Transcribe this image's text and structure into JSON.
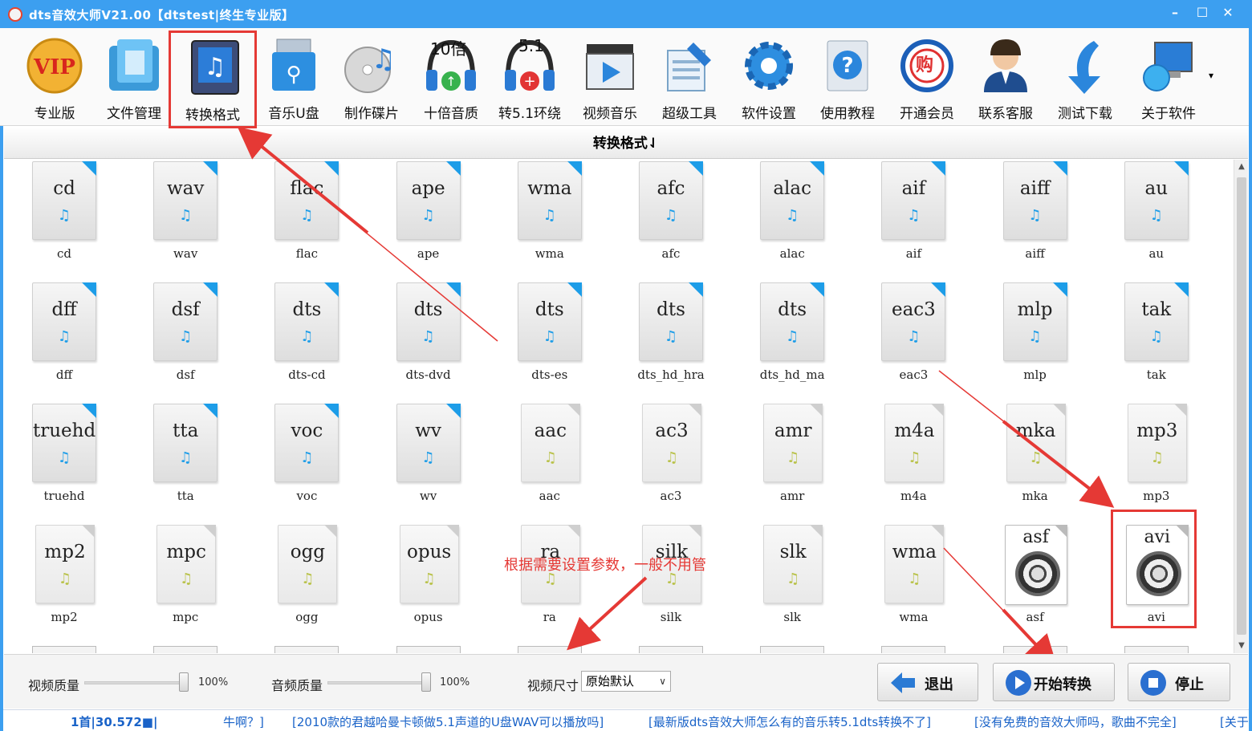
{
  "window": {
    "title": "dts音效大师V21.00【dtstest|终生专业版】",
    "controls": [
      "–",
      "☐",
      "✕"
    ]
  },
  "toolbar": {
    "items": [
      {
        "label": "专业版",
        "icon": "vip-icon"
      },
      {
        "label": "文件管理",
        "icon": "folder-icon"
      },
      {
        "label": "转换格式",
        "icon": "music-file-icon",
        "selected": true
      },
      {
        "label": "音乐U盘",
        "icon": "usb-drive-icon"
      },
      {
        "label": "制作碟片",
        "icon": "disc-icon"
      },
      {
        "label": "十倍音质",
        "icon": "headphones-10x-icon",
        "badge": "10倍"
      },
      {
        "label": "转5.1环绕",
        "icon": "headphones-51-icon",
        "badge": "5.1"
      },
      {
        "label": "视频音乐",
        "icon": "video-clapper-icon"
      },
      {
        "label": "超级工具",
        "icon": "tools-icon"
      },
      {
        "label": "软件设置",
        "icon": "gear-icon"
      },
      {
        "label": "使用教程",
        "icon": "help-icon"
      },
      {
        "label": "开通会员",
        "icon": "shopping-icon",
        "badge": "购"
      },
      {
        "label": "联系客服",
        "icon": "support-agent-icon"
      },
      {
        "label": "测试下载",
        "icon": "download-arrow-icon"
      },
      {
        "label": "关于软件",
        "icon": "computer-globe-icon"
      }
    ],
    "more": "▾"
  },
  "section": {
    "title": "转换格式⇃"
  },
  "formats": [
    {
      "ext": "cd",
      "caption": "cd",
      "kind": "audio"
    },
    {
      "ext": "wav",
      "caption": "wav",
      "kind": "audio"
    },
    {
      "ext": "flac",
      "caption": "flac",
      "kind": "audio"
    },
    {
      "ext": "ape",
      "caption": "ape",
      "kind": "audio"
    },
    {
      "ext": "wma",
      "caption": "wma",
      "kind": "audio"
    },
    {
      "ext": "afc",
      "caption": "afc",
      "kind": "audio"
    },
    {
      "ext": "alac",
      "caption": "alac",
      "kind": "audio"
    },
    {
      "ext": "aif",
      "caption": "aif",
      "kind": "audio"
    },
    {
      "ext": "aiff",
      "caption": "aiff",
      "kind": "audio"
    },
    {
      "ext": "au",
      "caption": "au",
      "kind": "audio"
    },
    {
      "ext": "dff",
      "caption": "dff",
      "kind": "audio"
    },
    {
      "ext": "dsf",
      "caption": "dsf",
      "kind": "audio"
    },
    {
      "ext": "dts",
      "caption": "dts-cd",
      "kind": "audio"
    },
    {
      "ext": "dts",
      "caption": "dts-dvd",
      "kind": "audio"
    },
    {
      "ext": "dts",
      "caption": "dts-es",
      "kind": "audio"
    },
    {
      "ext": "dts",
      "caption": "dts_hd_hra",
      "kind": "audio"
    },
    {
      "ext": "dts",
      "caption": "dts_hd_ma",
      "kind": "audio"
    },
    {
      "ext": "eac3",
      "caption": "eac3",
      "kind": "audio"
    },
    {
      "ext": "mlp",
      "caption": "mlp",
      "kind": "audio"
    },
    {
      "ext": "tak",
      "caption": "tak",
      "kind": "audio"
    },
    {
      "ext": "truehd",
      "caption": "truehd",
      "kind": "audio"
    },
    {
      "ext": "tta",
      "caption": "tta",
      "kind": "audio"
    },
    {
      "ext": "voc",
      "caption": "voc",
      "kind": "audio"
    },
    {
      "ext": "wv",
      "caption": "wv",
      "kind": "audio"
    },
    {
      "ext": "aac",
      "caption": "aac",
      "kind": "doc"
    },
    {
      "ext": "ac3",
      "caption": "ac3",
      "kind": "doc"
    },
    {
      "ext": "amr",
      "caption": "amr",
      "kind": "doc"
    },
    {
      "ext": "m4a",
      "caption": "m4a",
      "kind": "doc"
    },
    {
      "ext": "mka",
      "caption": "mka",
      "kind": "doc"
    },
    {
      "ext": "mp3",
      "caption": "mp3",
      "kind": "doc"
    },
    {
      "ext": "mp2",
      "caption": "mp2",
      "kind": "doc"
    },
    {
      "ext": "mpc",
      "caption": "mpc",
      "kind": "doc"
    },
    {
      "ext": "ogg",
      "caption": "ogg",
      "kind": "doc"
    },
    {
      "ext": "opus",
      "caption": "opus",
      "kind": "doc"
    },
    {
      "ext": "ra",
      "caption": "ra",
      "kind": "doc"
    },
    {
      "ext": "silk",
      "caption": "silk",
      "kind": "doc"
    },
    {
      "ext": "slk",
      "caption": "slk",
      "kind": "doc"
    },
    {
      "ext": "wma",
      "caption": "wma",
      "kind": "doc"
    },
    {
      "ext": "asf",
      "caption": "asf",
      "kind": "video"
    },
    {
      "ext": "avi",
      "caption": "avi",
      "kind": "video",
      "highlighted": true
    }
  ],
  "annotation": {
    "text": "根据需要设置参数，一般不用管"
  },
  "controls": {
    "video_quality": {
      "label": "视频质量",
      "value": "100%"
    },
    "audio_quality": {
      "label": "音频质量",
      "value": "100%"
    },
    "video_size": {
      "label": "视频尺寸",
      "value": "原始默认"
    }
  },
  "buttons": {
    "exit": "退出",
    "start": "开始转换",
    "stop": "停止"
  },
  "status": {
    "count": "1首|30.572■|",
    "links": [
      "牛啊？]",
      "[2010款的君越哈曼卡顿做5.1声道的U盘WAV可以播放吗]",
      "[最新版dts音效大师怎么有的音乐转5.1dts转换不了]",
      "[没有免费的音效大师吗，歌曲不完全]",
      "[关于"
    ]
  },
  "colors": {
    "titlebar": "#3c9ff0",
    "accent_blue": "#1d9de8",
    "annotation_red": "#e53935",
    "link_blue": "#1a63c8"
  }
}
